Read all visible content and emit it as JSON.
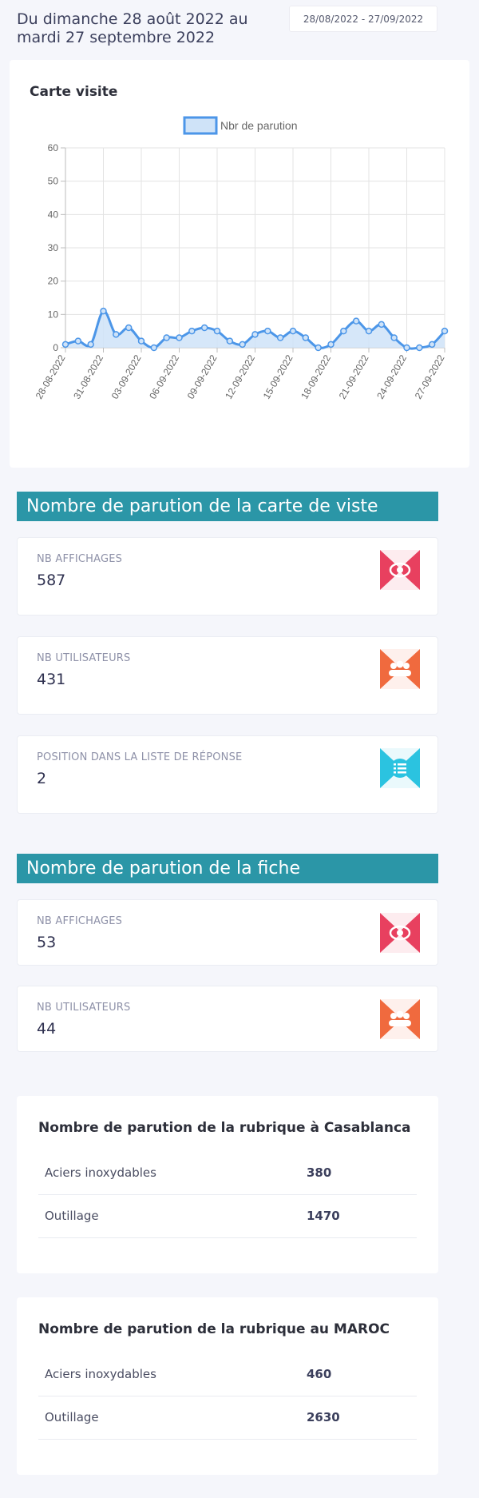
{
  "header": {
    "period_text": "Du dimanche 28 août 2022 au mardi 27 septembre 2022",
    "date_range_value": "28/08/2022 - 27/09/2022"
  },
  "chart_card": {
    "title": "Carte visite"
  },
  "chart_data": {
    "type": "line",
    "title": "",
    "legend": [
      "Nbr de parution"
    ],
    "legend_position": "top",
    "series": [
      {
        "name": "Nbr de parution",
        "values": [
          1,
          2,
          1,
          11,
          4,
          6,
          2,
          0,
          3,
          3,
          5,
          6,
          5,
          2,
          1,
          4,
          5,
          3,
          5,
          3,
          0,
          1,
          5,
          8,
          5,
          7,
          3,
          0,
          0,
          1,
          5
        ]
      }
    ],
    "x": [
      "28-08-2022",
      "29-08-2022",
      "30-08-2022",
      "31-08-2022",
      "01-09-2022",
      "02-09-2022",
      "03-09-2022",
      "04-09-2022",
      "05-09-2022",
      "06-09-2022",
      "07-09-2022",
      "08-09-2022",
      "09-09-2022",
      "10-09-2022",
      "11-09-2022",
      "12-09-2022",
      "13-09-2022",
      "14-09-2022",
      "15-09-2022",
      "16-09-2022",
      "17-09-2022",
      "18-09-2022",
      "19-09-2022",
      "20-09-2022",
      "21-09-2022",
      "22-09-2022",
      "23-09-2022",
      "24-09-2022",
      "25-09-2022",
      "26-09-2022",
      "27-09-2022"
    ],
    "x_tick_labels": [
      "28-08-2022",
      "31-08-2022",
      "03-09-2022",
      "06-09-2022",
      "09-09-2022",
      "12-09-2022",
      "15-09-2022",
      "18-09-2022",
      "21-09-2022",
      "24-09-2022",
      "27-09-2022"
    ],
    "y_ticks": [
      0,
      10,
      20,
      30,
      40,
      50,
      60
    ],
    "ylim": [
      0,
      60
    ],
    "grid": true,
    "colors": {
      "line": "#4c96e8",
      "fill": "#cfe3f8",
      "point": "#4c96e8"
    }
  },
  "section_cards": {
    "header": "Nombre de parution de la carte de viste",
    "stats": [
      {
        "label": "NB AFFICHAGES",
        "value": "587",
        "icon": "eye-icon"
      },
      {
        "label": "NB UTILISATEURS",
        "value": "431",
        "icon": "users-icon"
      },
      {
        "label": "POSITION DANS LA LISTE DE RÉPONSE",
        "value": "2",
        "icon": "list-icon"
      }
    ]
  },
  "section_fiche": {
    "header": "Nombre de parution de la fiche",
    "stats": [
      {
        "label": "NB AFFICHAGES",
        "value": "53",
        "icon": "eye-icon"
      },
      {
        "label": "NB UTILISATEURS",
        "value": "44",
        "icon": "users-icon"
      }
    ]
  },
  "table_casablanca": {
    "title": "Nombre de parution de la rubrique à Casablanca",
    "rows": [
      {
        "name": "Aciers inoxydables",
        "value": "380"
      },
      {
        "name": "Outillage",
        "value": "1470"
      }
    ]
  },
  "table_maroc": {
    "title": "Nombre de parution de la rubrique au MAROC",
    "rows": [
      {
        "name": "Aciers inoxydables",
        "value": "460"
      },
      {
        "name": "Outillage",
        "value": "2630"
      }
    ]
  },
  "colors": {
    "section_header_bg": "#2b96a7",
    "eye_icon": "#e8405f",
    "users_icon": "#f06a3e",
    "list_icon": "#2bc3e0"
  }
}
